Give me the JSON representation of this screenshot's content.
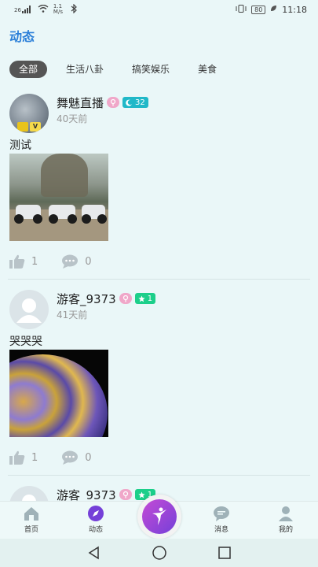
{
  "status_bar": {
    "signal": "26",
    "speed": "1.1 M/s",
    "battery": "80",
    "time": "11:18"
  },
  "header": {
    "title": "动态"
  },
  "tabs": [
    {
      "label": "全部",
      "active": true
    },
    {
      "label": "生活八卦",
      "active": false
    },
    {
      "label": "搞笑娱乐",
      "active": false
    },
    {
      "label": "美食",
      "active": false
    }
  ],
  "posts": [
    {
      "author": "舞魅直播",
      "level": "32",
      "time_ago": "40天前",
      "text": "测试",
      "likes": "1",
      "comments": "0"
    },
    {
      "author": "游客_9373",
      "level": "1",
      "time_ago": "41天前",
      "text": "哭哭哭",
      "likes": "1",
      "comments": "0"
    },
    {
      "author": "游客_9373",
      "level": "1"
    }
  ],
  "bottom_nav": {
    "home": "首页",
    "feed": "动态",
    "messages": "消息",
    "mine": "我的"
  },
  "colors": {
    "accent": "#2b7fd8",
    "badge_blue": "#20b8c8",
    "badge_green": "#1ccf8a",
    "center_button": "#7540d8"
  }
}
